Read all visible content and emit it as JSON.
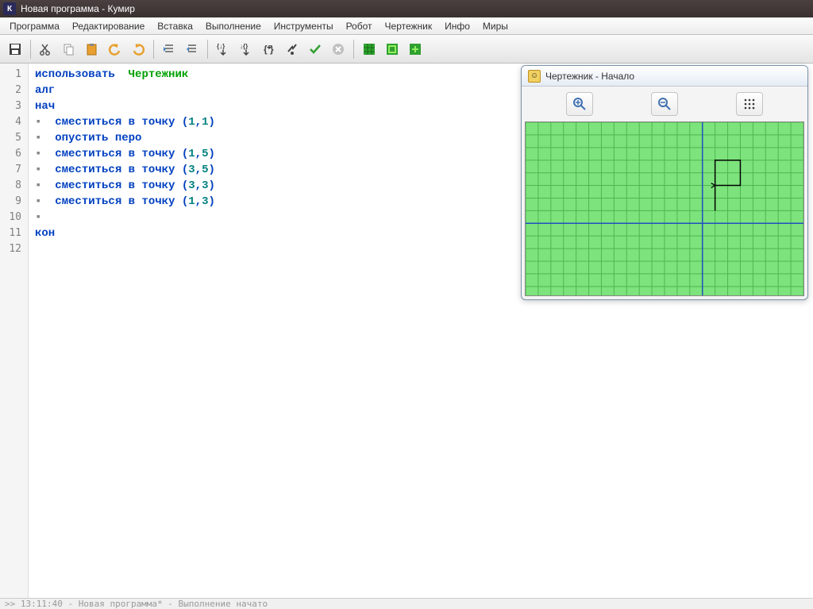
{
  "title": "Новая программа - Кумир",
  "app_letter": "К",
  "menu": [
    "Программа",
    "Редактирование",
    "Вставка",
    "Выполнение",
    "Инструменты",
    "Робот",
    "Чертежник",
    "Инфо",
    "Миры"
  ],
  "code": {
    "lines": [
      {
        "n": "1",
        "t": "use",
        "kw": "использовать",
        "mod": "Чертежник"
      },
      {
        "n": "2",
        "t": "kw",
        "kw": "алг"
      },
      {
        "n": "3",
        "t": "kw",
        "kw": "нач"
      },
      {
        "n": "4",
        "t": "move",
        "kw": "сместиться в точку",
        "a": "1",
        "b": "1"
      },
      {
        "n": "5",
        "t": "cmd",
        "kw": "опустить перо"
      },
      {
        "n": "6",
        "t": "move",
        "kw": "сместиться в точку",
        "a": "1",
        "b": "5"
      },
      {
        "n": "7",
        "t": "move",
        "kw": "сместиться в точку",
        "a": "3",
        "b": "5"
      },
      {
        "n": "8",
        "t": "move",
        "kw": "сместиться в точку",
        "a": "3",
        "b": "3"
      },
      {
        "n": "9",
        "t": "move",
        "kw": "сместиться в точку",
        "a": "1",
        "b": "3"
      },
      {
        "n": "10",
        "t": "bullet"
      },
      {
        "n": "11",
        "t": "kw",
        "kw": "кон"
      },
      {
        "n": "12",
        "t": "empty"
      }
    ]
  },
  "panel": {
    "title": "Чертежник - Начало"
  },
  "status": ">> 13:11:40 - Новая программа* - Выполнение начато"
}
